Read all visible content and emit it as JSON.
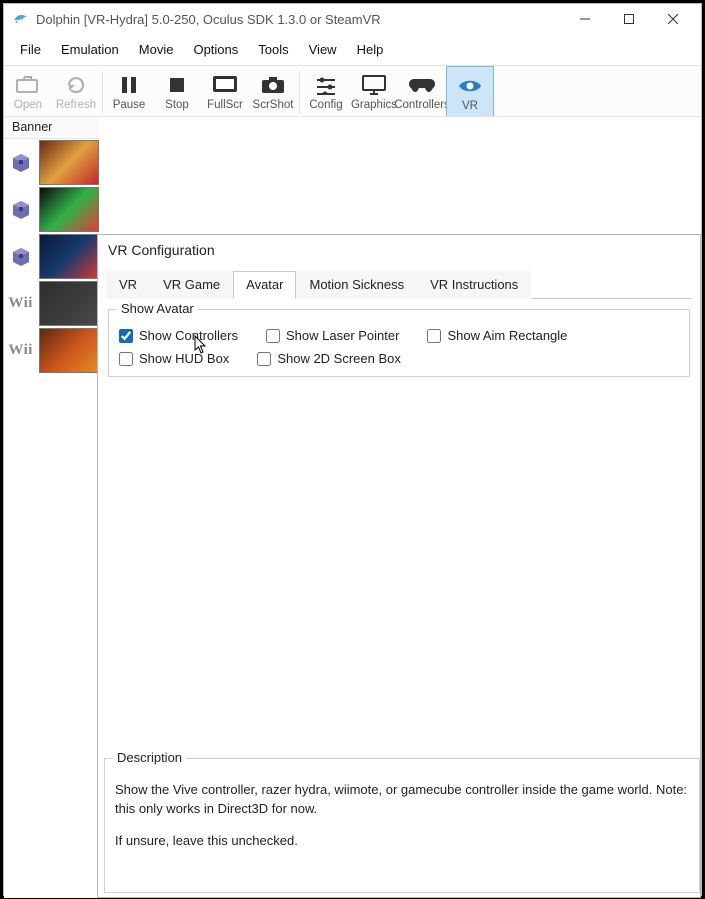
{
  "window": {
    "title": "Dolphin [VR-Hydra] 5.0-250, Oculus SDK 1.3.0 or SteamVR"
  },
  "menu": {
    "file": "File",
    "emulation": "Emulation",
    "movie": "Movie",
    "options": "Options",
    "tools": "Tools",
    "view": "View",
    "help": "Help"
  },
  "toolbar": {
    "open": "Open",
    "refresh": "Refresh",
    "pause": "Pause",
    "stop": "Stop",
    "fullscr": "FullScr",
    "scrshot": "ScrShot",
    "config": "Config",
    "graphics": "Graphics",
    "controllers": "Controllers",
    "vr": "VR"
  },
  "list": {
    "column_banner": "Banner",
    "rows": [
      {
        "platform": "gc",
        "banner_colors": [
          "#6a2b17",
          "#e0a040",
          "#c02a2a"
        ]
      },
      {
        "platform": "gc",
        "banner_colors": [
          "#0a0a0a",
          "#2fb24a",
          "#e63a3a"
        ]
      },
      {
        "platform": "gc",
        "banner_colors": [
          "#0b1b3a",
          "#173a6a",
          "#d23a3a"
        ]
      },
      {
        "platform": "wii",
        "banner_colors": [
          "#2f2f2f",
          "#3a3a3a",
          "#4a4a4a"
        ]
      },
      {
        "platform": "wii",
        "banner_colors": [
          "#5a2a14",
          "#c8531a",
          "#e68a2a"
        ]
      }
    ]
  },
  "dialog": {
    "title": "VR Configuration",
    "tabs": {
      "vr": "VR",
      "vr_game": "VR Game",
      "avatar": "Avatar",
      "motion_sickness": "Motion Sickness",
      "vr_instructions": "VR Instructions"
    },
    "avatar": {
      "group_label": "Show Avatar",
      "checks": {
        "controllers": {
          "label": "Show Controllers",
          "checked": true
        },
        "laser": {
          "label": "Show Laser Pointer",
          "checked": false
        },
        "aimrect": {
          "label": "Show Aim Rectangle",
          "checked": false
        },
        "hudbox": {
          "label": "Show HUD Box",
          "checked": false
        },
        "screenbox": {
          "label": "Show 2D Screen Box",
          "checked": false
        }
      }
    },
    "description": {
      "label": "Description",
      "line1": "Show the Vive controller, razer hydra, wiimote, or gamecube controller inside the game world. Note: this only works in Direct3D for now.",
      "line2": "If unsure, leave this unchecked."
    }
  }
}
